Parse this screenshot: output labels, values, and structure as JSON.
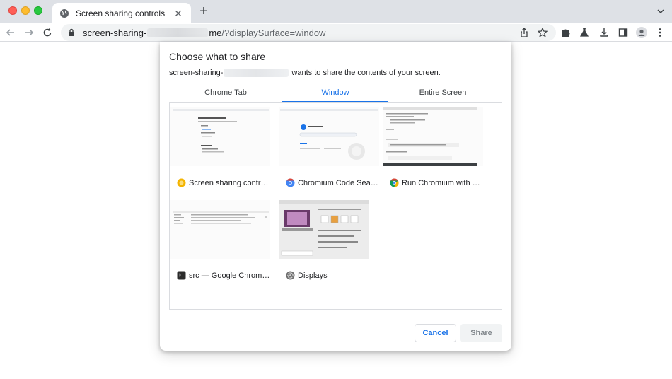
{
  "browser": {
    "tab_title": "Screen sharing controls",
    "tab_close": "✕",
    "new_tab": "+",
    "url_host_start": "screen-sharing-",
    "url_host_end": "me",
    "url_path": "/?displaySurface=window"
  },
  "dialog": {
    "title": "Choose what to share",
    "subtitle_site": "screen-sharing-",
    "subtitle_rest": "wants to share the contents of your screen.",
    "tabs": [
      {
        "label": "Chrome Tab"
      },
      {
        "label": "Window"
      },
      {
        "label": "Entire Screen"
      }
    ],
    "active_tab": "Window",
    "windows": [
      {
        "label": "Screen sharing controls",
        "icon": "yellow-globe-icon"
      },
      {
        "label": "Chromium Code Searc...",
        "icon": "chromium-icon"
      },
      {
        "label": "Run Chromium with co...",
        "icon": "chrome-icon"
      },
      {
        "label": "src — Google Chrome...",
        "icon": "terminal-icon"
      },
      {
        "label": "Displays",
        "icon": "system-preferences-icon"
      }
    ],
    "cancel_label": "Cancel",
    "share_label": "Share"
  },
  "colors": {
    "accent": "#1a73e8",
    "tab_strip": "#dee1e6",
    "omnibox": "#f1f3f4"
  }
}
